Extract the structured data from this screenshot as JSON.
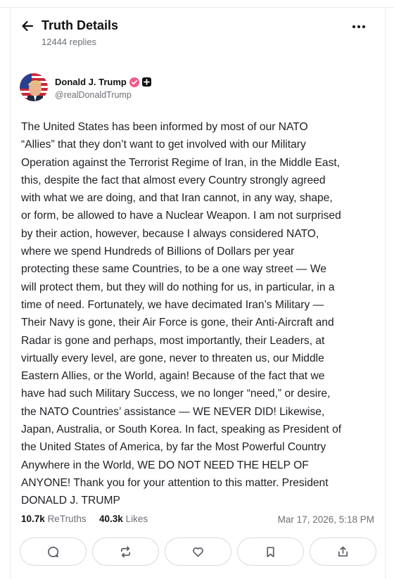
{
  "header": {
    "title": "Truth Details",
    "replies": "12444 replies",
    "back_icon": "arrow-left-icon",
    "more_icon": "more-horizontal-icon"
  },
  "author": {
    "display_name": "Donald J. Trump",
    "handle": "@realDonaldTrump",
    "verified_color": "#f25b8a"
  },
  "post": {
    "text": "The United States has been informed by most of our NATO\n“Allies” that they don’t want to get involved with our Military\nOperation against the Terrorist Regime of Iran, in the Middle East,\nthis, despite the fact that almost every Country strongly agreed\nwith what we are doing, and that Iran cannot, in any way, shape,\nor form, be allowed to have a Nuclear Weapon. I am not surprised\nby their action, however, because I always considered NATO,\nwhere we spend Hundreds of Billions of Dollars per year\nprotecting these same Countries, to be a one way street — We\nwill protect them, but they will do nothing for us, in particular, in a\ntime of need. Fortunately, we have decimated Iran’s Military —\nTheir Navy is gone, their Air Force is gone, their Anti-Aircraft and\nRadar is gone and perhaps, most importantly, their Leaders, at\nvirtually every level, are gone, never to threaten us, our Middle\nEastern Allies, or the World, again! Because of the fact that we\nhave had such Military Success, we no longer “need,” or desire,\nthe NATO Countries’ assistance — WE NEVER DID! Likewise,\nJapan, Australia, or South Korea. In fact, speaking as President of\nthe United States of America, by far the Most Powerful Country\nAnywhere in the World, WE DO NOT NEED THE HELP OF\nANYONE! Thank you for your attention to this matter. President\nDONALD J. TRUMP"
  },
  "stats": {
    "retruths_count": "10.7k",
    "retruths_label": "ReTruths",
    "likes_count": "40.3k",
    "likes_label": "Likes",
    "timestamp": "Mar 17, 2026, 5:18 PM"
  },
  "actions": [
    {
      "name": "reply",
      "icon": "comment-icon"
    },
    {
      "name": "retruth",
      "icon": "repost-icon"
    },
    {
      "name": "like",
      "icon": "heart-icon"
    },
    {
      "name": "bookmark",
      "icon": "bookmark-icon"
    },
    {
      "name": "share",
      "icon": "share-icon"
    }
  ]
}
